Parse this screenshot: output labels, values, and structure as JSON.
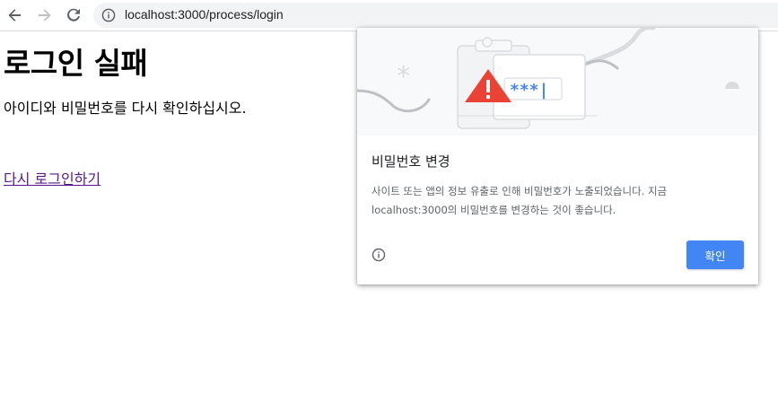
{
  "browser": {
    "url": "localhost:3000/process/login"
  },
  "page": {
    "title": "로그인 실패",
    "message": "아이디와 비밀번호를 다시 확인하십시오.",
    "retry_link": "다시 로그인하기"
  },
  "dialog": {
    "illustration_text": "***|",
    "title": "비밀번호 변경",
    "body_line1": "사이트 또는 앱의 정보 유출로 인해 비밀번호가 노출되었습니다. 지금",
    "body_line2": "localhost:3000의 비밀번호를 변경하는 것이 좋습니다.",
    "ok_label": "확인"
  },
  "colors": {
    "accent": "#4285f4",
    "warning": "#ea4335",
    "link_visited": "#551a8b"
  }
}
